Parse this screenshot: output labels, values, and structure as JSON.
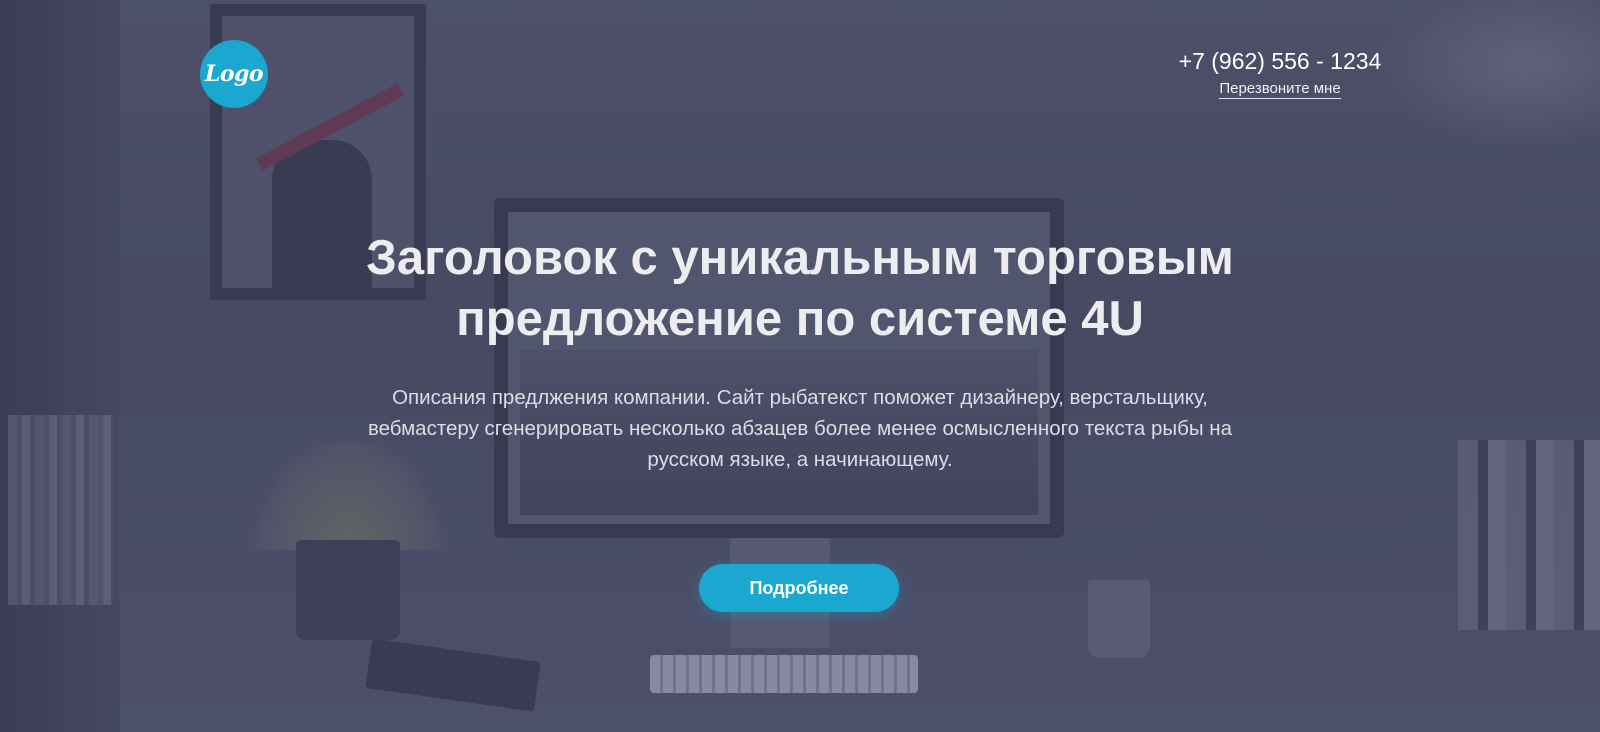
{
  "header": {
    "logo_text": "Logo",
    "phone": "+7 (962) 556 - 1234",
    "callback_label": "Перезвоните мне"
  },
  "hero": {
    "headline_line1": "Заголовок с уникальным торговым",
    "headline_line2": "предложение по системе 4U",
    "description_line1": "Описания предлжения компании. Сайт рыбатекст поможет дизайнеру, верстальщику,",
    "description_line2": "вебмастеру сгенерировать несколько абзацев более менее осмысленного текста рыбы на",
    "description_line3": "русском языке, а начинающему.",
    "cta_label": "Подробнее"
  },
  "colors": {
    "accent": "#1aa8d0",
    "overlay": "#4a4d66",
    "text": "#ececf1"
  }
}
